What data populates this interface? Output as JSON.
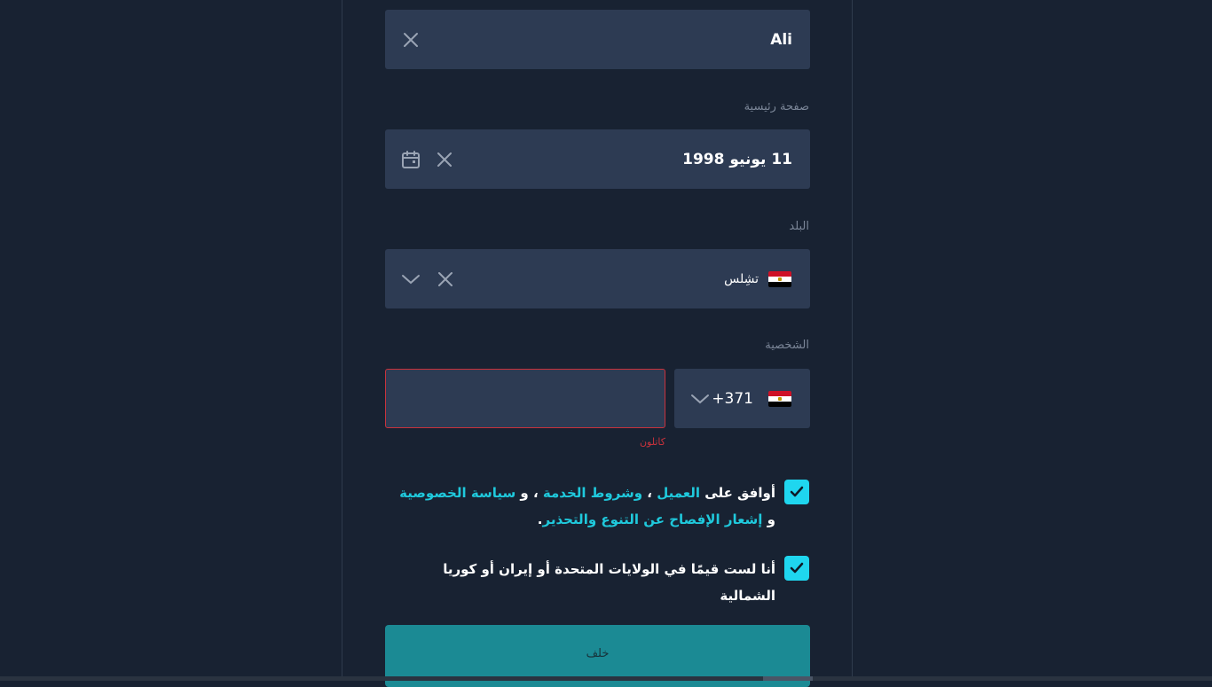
{
  "form": {
    "name_value": "Ali",
    "birthdate_label": "صفحة رئيسية",
    "birthdate_value": "11 يونيو 1998",
    "country_label": "البلد",
    "country_value": "تشِلس",
    "phone_label": "الشخصية",
    "phone_code": "+371",
    "phone_value": "",
    "phone_error": "كاتلون",
    "submit_label": "خلف"
  },
  "agreement": {
    "prefix": "أوافق على ",
    "link_client": "العميل",
    "sep1": " ، ",
    "link_terms": "وشروط الخدمة",
    "sep2": " ، و ",
    "link_privacy": "سياسة الخصوصية",
    "sep3": " و ",
    "link_disclosure": "إشعار الإفصاح عن التنوع والتحذير",
    "suffix": "."
  },
  "residency": {
    "text": "أنا لست قيمًا في الولايات المتحدة أو إيران أو كوريا الشمالية"
  },
  "colors": {
    "background": "#182232",
    "field": "#2d3b53",
    "accent": "#1fd6ef",
    "button": "#1b8a94",
    "error": "#c8323c"
  },
  "icons": {
    "clear": "close-icon",
    "calendar": "calendar-icon",
    "dropdown": "chevron-down-icon",
    "check": "check-icon",
    "flag": "egypt-flag-icon"
  }
}
